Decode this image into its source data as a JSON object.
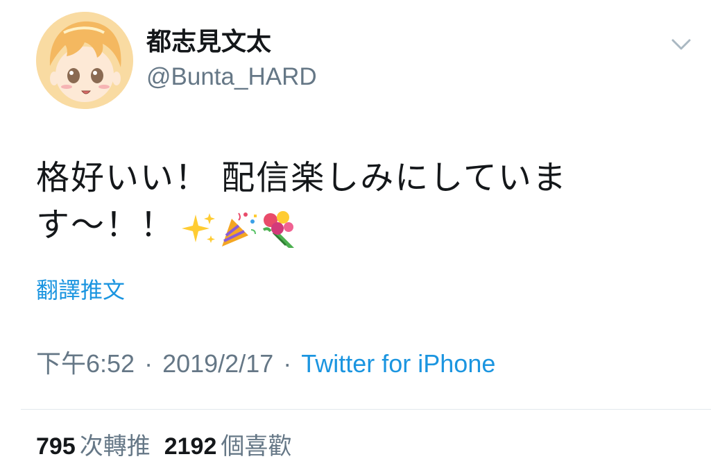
{
  "user": {
    "display_name": "都志見文太",
    "handle": "@Bunta_HARD"
  },
  "tweet": {
    "text_line1": "格好いい！ 配信楽しみにしていま",
    "text_line2": "す～！！",
    "emojis": [
      "sparkles-emoji",
      "party-popper-emoji",
      "bouquet-emoji"
    ],
    "translate_label": "翻譯推文"
  },
  "meta": {
    "time": "下午6:52",
    "separator": "·",
    "date": "2019/2/17",
    "source": "Twitter for iPhone"
  },
  "stats": {
    "retweets_count": "795",
    "retweets_label": "次轉推",
    "likes_count": "2192",
    "likes_label": "個喜歡"
  },
  "colors": {
    "link": "#1b95e0",
    "secondary": "#657786",
    "primary": "#14171a",
    "divider": "#e1e8ed"
  }
}
